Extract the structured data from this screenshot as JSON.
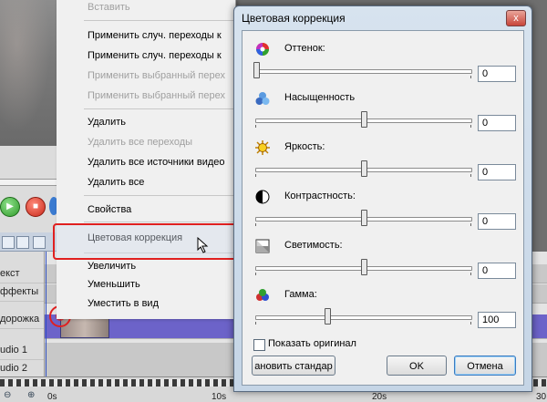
{
  "context_menu": {
    "items": [
      {
        "label": "Вставить",
        "disabled": true
      },
      {
        "label": "Применить случ. переходы к",
        "disabled": false
      },
      {
        "label": "Применить случ. переходы к",
        "disabled": false
      },
      {
        "label": "Применить выбранный перех",
        "disabled": true
      },
      {
        "label": "Применить выбранный перех",
        "disabled": true
      },
      {
        "label": "Удалить",
        "disabled": false
      },
      {
        "label": "Удалить все переходы",
        "disabled": true
      },
      {
        "label": "Удалить все источники видео",
        "disabled": false
      },
      {
        "label": "Удалить все",
        "disabled": false
      },
      {
        "label": "Свойства",
        "disabled": false
      },
      {
        "label": "Цветовая коррекция",
        "disabled": false,
        "highlighted": true
      },
      {
        "label": "Увеличить",
        "disabled": false
      },
      {
        "label": "Уменьшить",
        "disabled": false
      },
      {
        "label": "Уместить в вид",
        "disabled": false
      }
    ]
  },
  "timeline": {
    "tracks": [
      "екст",
      "ффекты",
      "дорожка",
      "udio 1",
      "udio 2"
    ],
    "ruler": [
      "0s",
      "10s",
      "20s",
      "30"
    ]
  },
  "dialog": {
    "title": "Цветовая коррекция",
    "close_glyph": "x",
    "params": [
      {
        "label": "Оттенок:",
        "value": "0",
        "position": 0.0,
        "icon": "color-wheel-icon"
      },
      {
        "label": "Насыщенность",
        "value": "0",
        "position": 0.5,
        "icon": "saturation-icon"
      },
      {
        "label": "Яркость:",
        "value": "0",
        "position": 0.5,
        "icon": "brightness-sun-icon"
      },
      {
        "label": "Контрастность:",
        "value": "0",
        "position": 0.5,
        "icon": "contrast-icon"
      },
      {
        "label": "Светимость:",
        "value": "0",
        "position": 0.5,
        "icon": "luminance-icon"
      },
      {
        "label": "Гамма:",
        "value": "100",
        "position": 0.33,
        "icon": "gamma-icon"
      }
    ],
    "show_original_label": "Показать оригинал",
    "reset_label": "ановить стандар",
    "ok_label": "OK",
    "cancel_label": "Отмена"
  },
  "colors": {
    "highlight_ring": "#e02020",
    "video_track": "#6c63c9",
    "dialog_frame": "#c5d5e6"
  }
}
